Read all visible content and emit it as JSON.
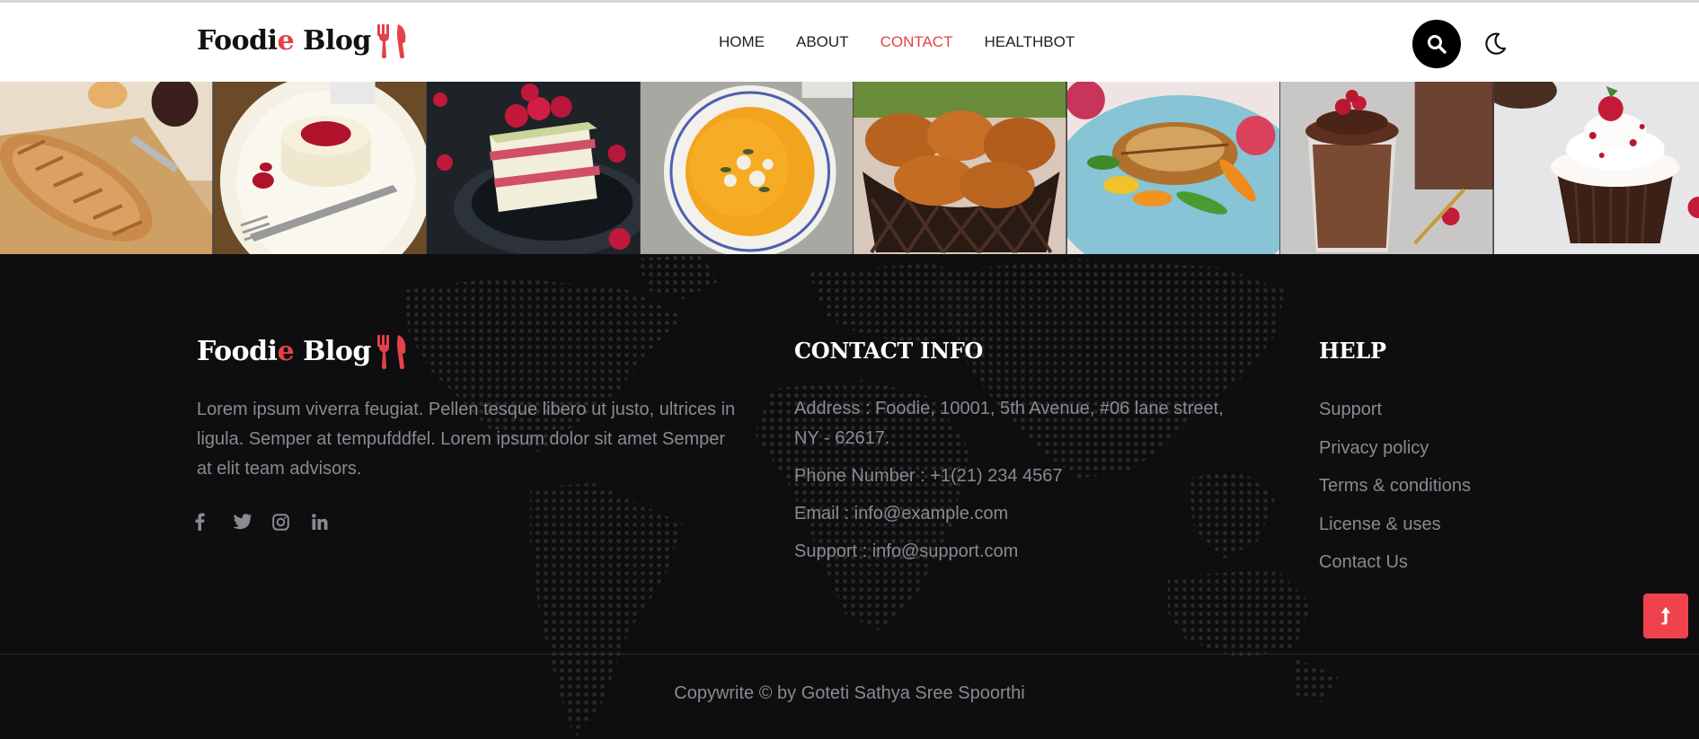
{
  "header": {
    "logo": {
      "text_main": "Foodi",
      "text_accent": "e",
      "text_tail": " Blog"
    },
    "nav": [
      {
        "label": "HOME",
        "active": false
      },
      {
        "label": "ABOUT",
        "active": false
      },
      {
        "label": "CONTACT",
        "active": true
      },
      {
        "label": "HEALTHBOT",
        "active": false
      }
    ],
    "search_icon": "search-icon",
    "theme_icon": "moon-icon"
  },
  "gallery": {
    "images": [
      "bread-loaf",
      "panna-cotta",
      "raspberry-cake",
      "pumpkin-soup",
      "fried-chicken",
      "grilled-fish",
      "chocolate-mousse",
      "cupcake"
    ]
  },
  "footer": {
    "logo": {
      "text_main": "Foodi",
      "text_accent": "e",
      "text_tail": " Blog"
    },
    "about": "Lorem ipsum viverra feugiat. Pellen tesque libero ut justo, ultrices in ligula. Semper at tempufddfel. Lorem ipsum dolor sit amet Semper at elit team advisors.",
    "socials": [
      "facebook-icon",
      "twitter-icon",
      "instagram-icon",
      "linkedin-icon"
    ],
    "contact": {
      "title": "CONTACT INFO",
      "items": [
        "Address : Foodie, 10001, 5th Avenue, #06 lane street, NY - 62617.",
        "Phone Number : +1(21) 234 4567",
        "Email : info@example.com",
        "Support : info@support.com"
      ]
    },
    "help": {
      "title": "HELP",
      "links": [
        "Support",
        "Privacy policy",
        "Terms & conditions",
        "License & uses",
        "Contact Us"
      ]
    },
    "copyright": "Copywrite © by Goteti Sathya Sree Spoorthi",
    "scroll_top_icon": "arrow-up-icon"
  },
  "colors": {
    "accent": "#e5414b",
    "footer_bg": "#0e0e10",
    "muted_text": "#8a8a8f",
    "scroll_button": "#f0424c"
  }
}
